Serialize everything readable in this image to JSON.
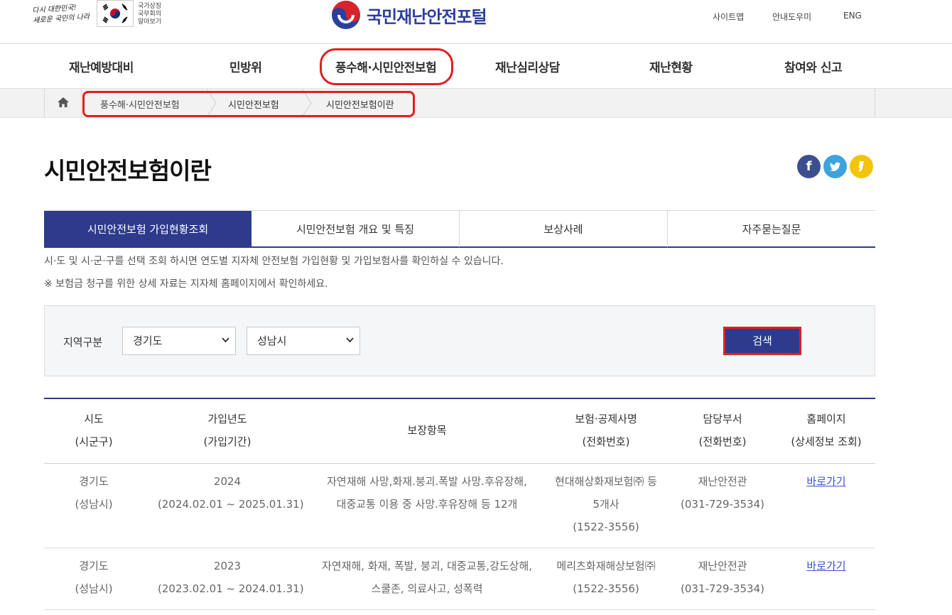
{
  "header": {
    "slogan_line1": "다시 대한민국!",
    "slogan_line2": "새로운 국민의 나라",
    "national_symbol_label": "국가상징\n국무회의\n알아보기",
    "site_title": "국민재난안전포털",
    "util_links": [
      "사이트맵",
      "안내도우미",
      "ENG"
    ]
  },
  "gnb": {
    "items": [
      "재난예방대비",
      "민방위",
      "풍수해·시민안전보험",
      "재난심리상담",
      "재난현황",
      "참여와 신고"
    ]
  },
  "breadcrumb": {
    "items": [
      "풍수해·시민안전보험",
      "시민안전보험",
      "시민안전보험이란"
    ]
  },
  "page": {
    "title": "시민안전보험이란",
    "sns_icons": [
      "facebook-icon",
      "twitter-icon",
      "kakaostory-icon"
    ]
  },
  "tabs": [
    "시민안전보험 가입현황조회",
    "시민안전보험 개요 및 특징",
    "보상사례",
    "자주묻는질문"
  ],
  "description": {
    "line1": "시·도 및 시·군·구를 선택 조회 하시면 연도별 지자체 안전보험 가입현황 및 가입보험사를 확인하실 수 있습니다.",
    "line2": "※ 보험금 청구를 위한 상세 자료는 지자체 홈페이지에서 확인하세요."
  },
  "search": {
    "label": "지역구분",
    "province_value": "경기도",
    "city_value": "성남시",
    "button_label": "검색"
  },
  "table": {
    "headers": [
      {
        "line1": "시도",
        "line2": "(시군구)"
      },
      {
        "line1": "가입년도",
        "line2": "(가입기간)"
      },
      {
        "line1": "보장항목",
        "line2": ""
      },
      {
        "line1": "보험·공제사명",
        "line2": "(전화번호)"
      },
      {
        "line1": "담당부서",
        "line2": "(전화번호)"
      },
      {
        "line1": "홈페이지",
        "line2": "(상세정보 조회)"
      }
    ],
    "rows": [
      {
        "region": [
          "경기도",
          "(성남시)"
        ],
        "year": [
          "2024",
          "(2024.02.01 ~ 2025.01.31)"
        ],
        "coverage": [
          "자연재해 사망,화재.붕괴.폭발 사망.후유장해,",
          "대중교통 이용 중 사망.후유장해 등 12개"
        ],
        "insurer": [
          "현대해상화재보험㈜ 등",
          "5개사",
          "(1522-3556)"
        ],
        "dept": [
          "재난안전관",
          "(031-729-3534)"
        ],
        "link": "바로가기"
      },
      {
        "region": [
          "경기도",
          "(성남시)"
        ],
        "year": [
          "2023",
          "(2023.02.01 ~ 2024.01.31)"
        ],
        "coverage": [
          "자연재해, 화재, 폭발, 붕괴, 대중교통,강도상해,",
          "스쿨존, 의료사고, 성폭력"
        ],
        "insurer": [
          "메리츠화재해상보험㈜",
          "(1522-3556)"
        ],
        "dept": [
          "재난안전관",
          "(031-729-3534)"
        ],
        "link": "바로가기"
      }
    ]
  },
  "colors": {
    "brand_navy": "#2e3a8c",
    "annotation_red": "#e02020",
    "link_blue": "#3b55c9"
  }
}
